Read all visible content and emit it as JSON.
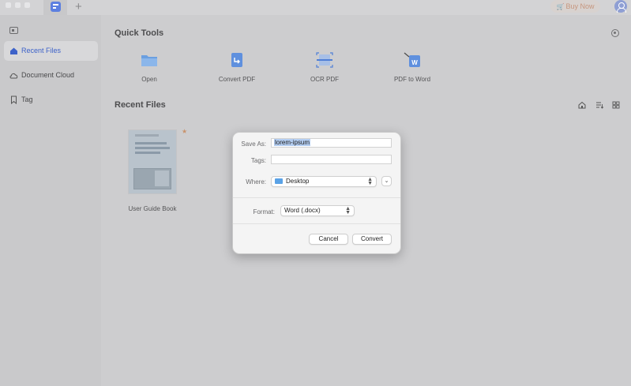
{
  "titlebar": {
    "new_tab": "+",
    "buy_now": "Buy Now",
    "icons": [
      "app-logo",
      "cart-icon",
      "avatar"
    ]
  },
  "sidebar": {
    "items": [
      {
        "label": "Recent Files",
        "icon": "home-icon",
        "active": true
      },
      {
        "label": "Document Cloud",
        "icon": "cloud-icon",
        "active": false
      },
      {
        "label": "Tag",
        "icon": "bookmark-icon",
        "active": false
      }
    ]
  },
  "quick_tools": {
    "title": "Quick Tools",
    "tools": [
      {
        "label": "Open",
        "icon": "folder-icon"
      },
      {
        "label": "Convert PDF",
        "icon": "convert-icon"
      },
      {
        "label": "OCR PDF",
        "icon": "ocr-icon"
      },
      {
        "label": "PDF to Word",
        "icon": "word-icon"
      }
    ]
  },
  "recent": {
    "title": "Recent Files",
    "files": [
      {
        "name": "User Guide Book"
      }
    ]
  },
  "dialog": {
    "save_as_label": "Save As:",
    "save_as_value": "lorem-ipsum",
    "tags_label": "Tags:",
    "tags_value": "",
    "where_label": "Where:",
    "where_value": "Desktop",
    "format_label": "Format:",
    "format_value": "Word (.docx)",
    "cancel": "Cancel",
    "convert": "Convert"
  },
  "colors": {
    "accent": "#3d62c9",
    "folder": "#5aa2e6",
    "buy_now": "#c6967e"
  }
}
